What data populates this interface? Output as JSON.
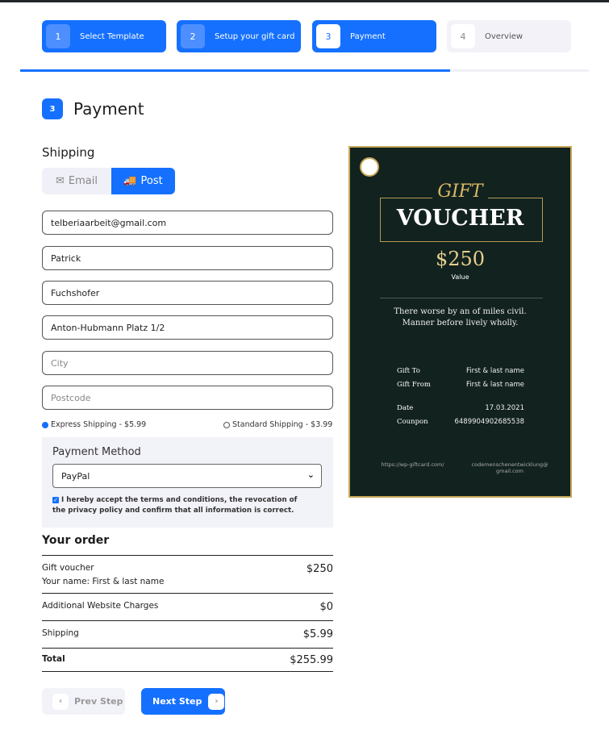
{
  "steps": [
    {
      "num": "1",
      "label": "Select Template",
      "state": "done"
    },
    {
      "num": "2",
      "label": "Setup your gift card",
      "state": "done"
    },
    {
      "num": "3",
      "label": "Payment",
      "state": "current"
    },
    {
      "num": "4",
      "label": "Overview",
      "state": "upcoming"
    }
  ],
  "progress_percent": 75,
  "section": {
    "num": "3",
    "title": "Payment"
  },
  "shipping": {
    "label": "Shipping",
    "email_label": "Email",
    "post_label": "Post",
    "selected": "Post"
  },
  "fields": {
    "email": "telberiaarbeit@gmail.com",
    "first_name": "Patrick",
    "last_name": "Fuchshofer",
    "street": "Anton-Hubmann Platz 1/2",
    "city_placeholder": "City",
    "postcode_placeholder": "Postcode"
  },
  "shipping_options": [
    {
      "label": "Express Shipping - $5.99",
      "selected": true
    },
    {
      "label": "Standard Shipping - $3.99",
      "selected": false
    }
  ],
  "payment": {
    "title": "Payment Method",
    "selected": "PayPal",
    "terms": "I hereby accept the terms and conditions, the revocation of the privacy policy and confirm that all information is correct.",
    "terms_checked": true
  },
  "order": {
    "title": "Your order",
    "item": "Gift voucher",
    "item_sub": "Your name: First & last name",
    "item_amount": "$250",
    "charges_label": "Additional Website Charges",
    "charges_amount": "$0",
    "shipping_label": "Shipping",
    "shipping_amount": "$5.99",
    "total_label": "Total",
    "total_amount": "$255.99"
  },
  "buttons": {
    "prev": "Prev Step",
    "next": "Next Step"
  },
  "voucher": {
    "gift": "GIFT",
    "voucher": "VOUCHER",
    "value": "$250",
    "value_label": "Value",
    "message_1": "There worse by an of miles civil.",
    "message_2": "Manner before lively wholly.",
    "gift_to_label": "Gift To",
    "gift_to": "First & last name",
    "gift_from_label": "Gift From",
    "gift_from": "First & last name",
    "date_label": "Date",
    "date": "17.03.2021",
    "coupon_label": "Counpon",
    "coupon": "6489904902685538",
    "url": "https://wp-giftcard.com/",
    "email_1": "codemenschenentwicklung@",
    "email_2": "gmail.com"
  },
  "colors": {
    "accent": "#1570ff",
    "card_bg": "#12221f",
    "gold": "#c8a95a"
  }
}
